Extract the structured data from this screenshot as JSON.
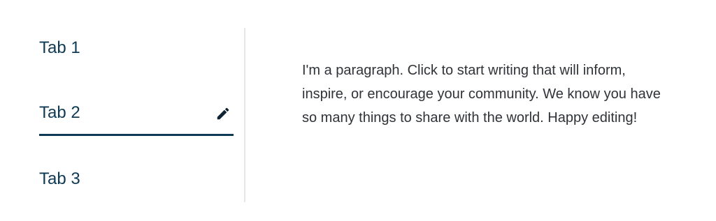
{
  "tabs": [
    {
      "label": "Tab 1"
    },
    {
      "label": "Tab 2",
      "selected": true
    },
    {
      "label": "Tab 3"
    }
  ],
  "edit_icon": "pencil-icon",
  "panel": {
    "paragraph": "I'm a paragraph. Click to start writing that will inform, inspire, or encourage your community. We know you have so many things to share with the world. Happy editing!"
  },
  "colors": {
    "tab_text": "#0f3a56",
    "active_underline": "#0f3a56",
    "paragraph_text": "#2f3338",
    "divider": "#e6e6e6",
    "background": "#ffffff"
  }
}
